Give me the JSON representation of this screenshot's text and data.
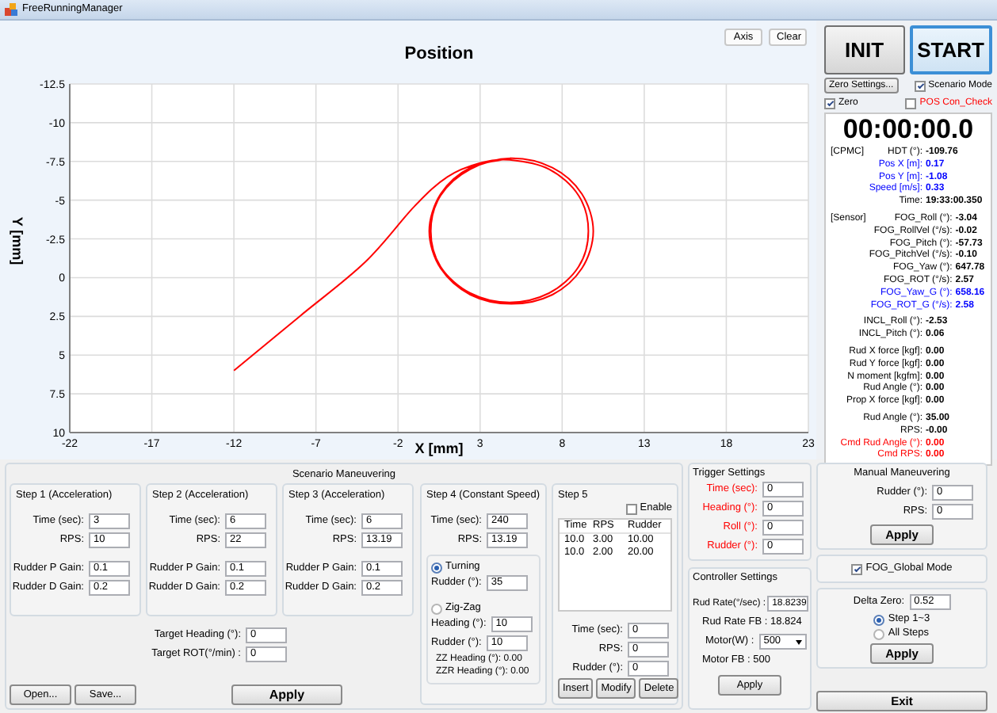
{
  "window": {
    "title": "FreeRunningManager"
  },
  "chart": {
    "buttons": [
      "Axis",
      "Clear"
    ],
    "chart_data": {
      "type": "line",
      "grid": true,
      "title": "Position",
      "xlabel": "X [mm]",
      "ylabel": "Y [mm]",
      "xlim": [
        -22,
        23
      ],
      "ylim": [
        10,
        -12.5
      ],
      "xticks": [
        -22,
        -17,
        -12,
        -7,
        -2,
        3,
        8,
        13,
        18,
        23
      ],
      "yticks": [
        -12.5,
        -10,
        -7.5,
        -5,
        -2.5,
        0,
        2.5,
        5,
        7.5,
        10
      ],
      "x": [
        -12,
        -8,
        -4,
        -1,
        1,
        3,
        4.8,
        7.2,
        9.0,
        9.6,
        9.0,
        7.2,
        4.8,
        2.4,
        0.6,
        0.0,
        0.6,
        2.4,
        4.9,
        7.4,
        9.2,
        9.9,
        9.2,
        7.4,
        4.9,
        2.4,
        0.6,
        -0.1,
        0.6,
        2.4,
        4.9
      ],
      "series": [
        {
          "color": "#ff0000",
          "values": [
            6,
            2.5,
            -1,
            -4.6,
            -6.5,
            -7.4,
            -7.6,
            -7.0,
            -5.3,
            -3.0,
            -0.7,
            1.0,
            1.6,
            1.0,
            -0.7,
            -3.0,
            -5.3,
            -7.0,
            -7.7,
            -7.1,
            -5.4,
            -3.0,
            -0.6,
            1.1,
            1.7,
            1.1,
            -0.6,
            -3.0,
            -5.4,
            -7.1,
            -7.7
          ]
        }
      ]
    }
  },
  "controls": {
    "buttons": [
      {
        "label": "INIT",
        "focused": false
      },
      {
        "label": "START",
        "focused": true
      }
    ],
    "zero_settings": "Zero Settings...",
    "checkboxes": [
      {
        "label": "Scenario Mode",
        "checked": true,
        "warning": false
      },
      {
        "label": "Zero",
        "checked": true,
        "warning": false
      },
      {
        "label": "POS Con_Check",
        "checked": false,
        "warning": true
      }
    ]
  },
  "clock": "00:00:00.0",
  "readout": {
    "sections": [
      {
        "tag": "[CPMC]",
        "rows": [
          {
            "label": "HDT (°):",
            "value": "-109.76",
            "color": "#000000"
          },
          {
            "label": "Pos X [m]:",
            "value": "0.17",
            "color": "#0000ff"
          },
          {
            "label": "Pos Y [m]:",
            "value": "-1.08",
            "color": "#0000ff"
          },
          {
            "label": "Speed [m/s]:",
            "value": "0.33",
            "color": "#0000ff"
          },
          {
            "label": "Time:",
            "value": "19:33:00.350",
            "color": "#000000"
          }
        ]
      },
      {
        "tag": "[Sensor]",
        "rows": [
          {
            "label": "FOG_Roll (°):",
            "value": "-3.04",
            "color": "#000000"
          },
          {
            "label": "FOG_RollVel (°/s):",
            "value": "-0.02",
            "color": "#000000"
          },
          {
            "label": "FOG_Pitch (°):",
            "value": "-57.73",
            "color": "#000000"
          },
          {
            "label": "FOG_PitchVel (°/s):",
            "value": "-0.10",
            "color": "#000000"
          },
          {
            "label": "FOG_Yaw (°):",
            "value": "647.78",
            "color": "#000000"
          },
          {
            "label": "FOG_ROT (°/s):",
            "value": "2.57",
            "color": "#000000"
          },
          {
            "label": "FOG_Yaw_G (°):",
            "value": "658.16",
            "color": "#0000ff"
          },
          {
            "label": "FOG_ROT_G (°/s):",
            "value": "2.58",
            "color": "#0000ff"
          }
        ]
      },
      {
        "rows": [
          {
            "label": "INCL_Roll (°):",
            "value": "-2.53",
            "color": "#000000"
          },
          {
            "label": "INCL_Pitch (°):",
            "value": "0.06",
            "color": "#000000"
          }
        ]
      },
      {
        "rows": [
          {
            "label": "Rud X force [kgf]:",
            "value": "0.00",
            "color": "#000000"
          },
          {
            "label": "Rud Y force [kgf]:",
            "value": "0.00",
            "color": "#000000"
          },
          {
            "label": "N moment [kgfm]:",
            "value": "0.00",
            "color": "#000000"
          },
          {
            "label": "Rud Angle (°):",
            "value": "0.00",
            "color": "#000000"
          },
          {
            "label": "Prop X force [kgf]:",
            "value": "0.00",
            "color": "#000000"
          }
        ]
      },
      {
        "rows": [
          {
            "label": "Rud Angle (°):",
            "value": "35.00",
            "color": "#000000"
          },
          {
            "label": "RPS:",
            "value": "-0.00",
            "color": "#000000"
          },
          {
            "label": "Cmd Rud Angle (°):",
            "value": "0.00",
            "color": "#ff0000"
          },
          {
            "label": "Cmd RPS:",
            "value": "0.00",
            "color": "#ff0000"
          }
        ]
      }
    ]
  },
  "scenario": {
    "title": "Scenario Maneuvering",
    "steps": [
      {
        "title": "Step 1 (Acceleration)",
        "fields": [
          {
            "label": "Time (sec):",
            "value": "3"
          },
          {
            "label": "RPS:",
            "value": "10"
          },
          {
            "label": "Rudder P Gain:",
            "value": "0.1"
          },
          {
            "label": "Rudder D Gain:",
            "value": "0.2"
          }
        ]
      },
      {
        "title": "Step 2 (Acceleration)",
        "fields": [
          {
            "label": "Time (sec):",
            "value": "6"
          },
          {
            "label": "RPS:",
            "value": "22"
          },
          {
            "label": "Rudder P Gain:",
            "value": "0.1"
          },
          {
            "label": "Rudder D Gain:",
            "value": "0.2"
          }
        ]
      },
      {
        "title": "Step 3 (Acceleration)",
        "fields": [
          {
            "label": "Time (sec):",
            "value": "6"
          },
          {
            "label": "RPS:",
            "value": "13.19"
          },
          {
            "label": "Rudder P Gain:",
            "value": "0.1"
          },
          {
            "label": "Rudder D Gain:",
            "value": "0.2"
          }
        ]
      }
    ],
    "target": [
      {
        "label": "Target Heading (°):",
        "value": "0"
      },
      {
        "label": "Target ROT(°/min) :",
        "value": "0"
      }
    ],
    "file_buttons": [
      "Open...",
      "Save..."
    ],
    "apply": "Apply",
    "step4": {
      "title": "Step 4 (Constant Speed)",
      "fields": [
        {
          "label": "Time (sec):",
          "value": "240"
        },
        {
          "label": "RPS:",
          "value": "13.19"
        }
      ],
      "modes": [
        {
          "label": "Turning",
          "selected": true,
          "fields": [
            {
              "label": "Rudder (°):",
              "value": "35"
            }
          ]
        },
        {
          "label": "Zig-Zag",
          "selected": false,
          "fields": [
            {
              "label": "Heading (°):",
              "value": "10"
            },
            {
              "label": "Rudder (°):",
              "value": "10"
            }
          ],
          "readouts": [
            "ZZ Heading (°): 0.00",
            "ZZR Heading (°): 0.00"
          ]
        }
      ]
    },
    "step5": {
      "title": "Step 5",
      "enable": {
        "label": "Enable",
        "checked": false
      },
      "table": {
        "columns": [
          "Time",
          "RPS",
          "Rudder"
        ],
        "rows": [
          [
            "10.0",
            "3.00",
            "10.00"
          ],
          [
            "10.0",
            "2.00",
            "20.00"
          ]
        ]
      },
      "fields": [
        {
          "label": "Time (sec):",
          "value": "0"
        },
        {
          "label": "RPS:",
          "value": "0"
        },
        {
          "label": "Rudder (°):",
          "value": "0"
        }
      ],
      "buttons": [
        "Insert",
        "Modify",
        "Delete"
      ]
    }
  },
  "trigger": {
    "title": "Trigger Settings",
    "fields": [
      {
        "label": "Time (sec):",
        "value": "0"
      },
      {
        "label": "Heading (°):",
        "value": "0"
      },
      {
        "label": "Roll (°):",
        "value": "0"
      },
      {
        "label": "Rudder (°):",
        "value": "0"
      }
    ]
  },
  "controller": {
    "title": "Controller Settings",
    "rud_rate": {
      "label": "Rud Rate(°/sec) :",
      "value": "18.8239"
    },
    "rud_rate_fb": "Rud Rate FB : 18.824",
    "motor": {
      "label": "Motor(W) :",
      "value": "500"
    },
    "motor_fb": "Motor FB : 500",
    "apply": "Apply"
  },
  "manual": {
    "title": "Manual Maneuvering",
    "fields": [
      {
        "label": "Rudder (°):",
        "value": "0"
      },
      {
        "label": "RPS:",
        "value": "0"
      }
    ],
    "apply": "Apply"
  },
  "fog_global": {
    "label": "FOG_Global Mode",
    "checked": true
  },
  "delta": {
    "field": {
      "label": "Delta Zero:",
      "value": "0.52"
    },
    "options": [
      {
        "label": "Step 1~3",
        "selected": true
      },
      {
        "label": "All Steps",
        "selected": false
      }
    ],
    "apply": "Apply"
  },
  "exit": "Exit"
}
